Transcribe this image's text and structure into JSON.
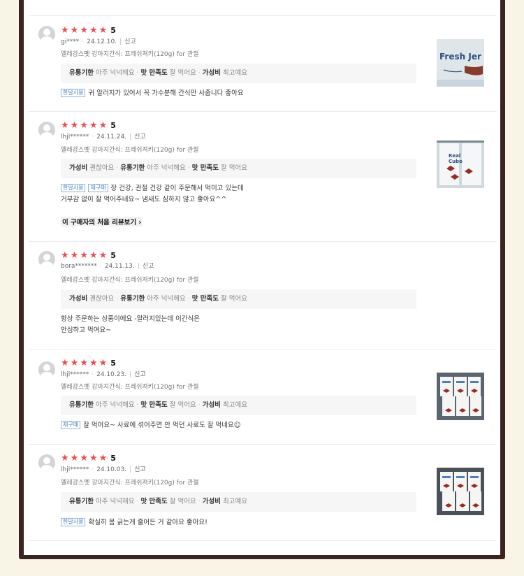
{
  "colors": {
    "star": "#f04a4a",
    "badge": "#4a7fc6",
    "frame": "#3b2420",
    "background": "#f8f5e6"
  },
  "report_label": "신고",
  "star_icon": "★",
  "reviews": [
    {
      "rating": 5,
      "score_label": "5",
      "user": "gi****",
      "date": "24.12.10.",
      "product": "엘레강스펫 강아지간식: 프레쉬져키(120g) for 관절",
      "tags": [
        [
          "유통기한",
          "아주 넉넉해요"
        ],
        [
          "맛 만족도",
          "잘 먹어요"
        ],
        [
          "가성비",
          "최고예요"
        ]
      ],
      "badges": [
        "한달사용"
      ],
      "lines": [
        "귀 알러지가 있어서 꼭 가수분해 간식만 사줍니다 좋아요"
      ],
      "more": "",
      "thumb_text": "Fresh Jer",
      "thumb_badge": ""
    },
    {
      "rating": 5,
      "score_label": "5",
      "user": "lhjl******",
      "date": "24.11.24.",
      "product": "엘레강스펫 강아지간식: 프레쉬져키(120g) for 관절",
      "tags": [
        [
          "가성비",
          "괜찮아요"
        ],
        [
          "유통기한",
          "아주 넉넉해요"
        ],
        [
          "맛 만족도",
          "잘 먹어요"
        ]
      ],
      "badges": [
        "한달사용",
        "재구매"
      ],
      "lines": [
        "장 건강, 관절 건강 같이 주문해서 먹이고 있는데",
        "거부감 없이 잘 먹어주네요~ 냄새도 심하지 않고 좋아요^^"
      ],
      "more": "이 구매자의 처음 리뷰보기",
      "thumb_text": "Real Cube",
      "thumb_badge": ""
    },
    {
      "rating": 5,
      "score_label": "5",
      "user": "bora*******",
      "date": "24.11.13.",
      "product": "엘레강스펫 강아지간식: 프레쉬져키(120g) for 관절",
      "tags": [
        [
          "가성비",
          "괜찮아요"
        ],
        [
          "유통기한",
          "아주 넉넉해요"
        ],
        [
          "맛 만족도",
          "잘 먹어요"
        ]
      ],
      "badges": [],
      "lines": [
        "항상 주문하는 상품이에요 -알러지있는데 이간식은",
        "안심하고 먹여요~"
      ],
      "more": "",
      "thumb_text": "",
      "thumb_badge": ""
    },
    {
      "rating": 5,
      "score_label": "5",
      "user": "lhjl******",
      "date": "24.10.23.",
      "product": "엘레강스펫 강아지간식: 프레쉬져키(120g) for 관절",
      "tags": [
        [
          "유통기한",
          "아주 넉넉해요"
        ],
        [
          "맛 만족도",
          "잘 먹어요"
        ],
        [
          "가성비",
          "최고예요"
        ]
      ],
      "badges": [
        "재구매"
      ],
      "lines": [
        "잘 먹어요~ 사료에 섞어주면 안 먹던 사료도 잘 먹네요☺"
      ],
      "more": "",
      "thumb_text": "",
      "thumb_badge": ""
    },
    {
      "rating": 5,
      "score_label": "5",
      "user": "lhjl******",
      "date": "24.10.03.",
      "product": "엘레강스펫 강아지간식: 프레쉬져키(120g) for 관절",
      "tags": [
        [
          "유통기한",
          "아주 넉넉해요"
        ],
        [
          "맛 만족도",
          "잘 먹어요"
        ],
        [
          "가성비",
          "최고예요"
        ]
      ],
      "badges": [
        "한달사용"
      ],
      "lines": [
        "확실히 몸 긁는게 줄어든 거 같아요 좋아요!"
      ],
      "more": "",
      "thumb_text": "",
      "thumb_badge": ""
    }
  ]
}
